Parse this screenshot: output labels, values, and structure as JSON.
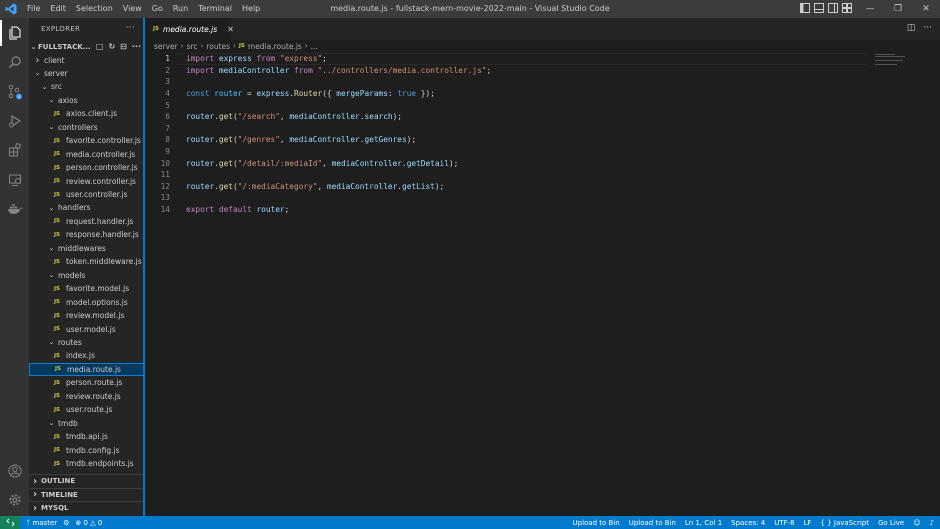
{
  "titlebar": {
    "menu": [
      "File",
      "Edit",
      "Selection",
      "View",
      "Go",
      "Run",
      "Terminal",
      "Help"
    ],
    "title": "media.route.js - fullstack-mern-movie-2022-main - Visual Studio Code"
  },
  "sidebar": {
    "header": "EXPLORER",
    "root": "FULLSTACK...",
    "tree": [
      {
        "label": "client",
        "kind": "folder",
        "open": false,
        "depth": 1
      },
      {
        "label": "server",
        "kind": "folder",
        "open": true,
        "depth": 1
      },
      {
        "label": "src",
        "kind": "folder",
        "open": true,
        "depth": 2
      },
      {
        "label": "axios",
        "kind": "folder",
        "open": true,
        "depth": 3
      },
      {
        "label": "axios.client.js",
        "kind": "file",
        "depth": 4
      },
      {
        "label": "controllers",
        "kind": "folder",
        "open": true,
        "depth": 3
      },
      {
        "label": "favorite.controller.js",
        "kind": "file",
        "depth": 4
      },
      {
        "label": "media.controller.js",
        "kind": "file",
        "depth": 4
      },
      {
        "label": "person.controller.js",
        "kind": "file",
        "depth": 4
      },
      {
        "label": "review.controller.js",
        "kind": "file",
        "depth": 4
      },
      {
        "label": "user.controller.js",
        "kind": "file",
        "depth": 4
      },
      {
        "label": "handlers",
        "kind": "folder",
        "open": true,
        "depth": 3
      },
      {
        "label": "request.handler.js",
        "kind": "file",
        "depth": 4
      },
      {
        "label": "response.handler.js",
        "kind": "file",
        "depth": 4
      },
      {
        "label": "middlewares",
        "kind": "folder",
        "open": true,
        "depth": 3
      },
      {
        "label": "token.middleware.js",
        "kind": "file",
        "depth": 4
      },
      {
        "label": "models",
        "kind": "folder",
        "open": true,
        "depth": 3
      },
      {
        "label": "favorite.model.js",
        "kind": "file",
        "depth": 4
      },
      {
        "label": "model.options.js",
        "kind": "file",
        "depth": 4
      },
      {
        "label": "review.model.js",
        "kind": "file",
        "depth": 4
      },
      {
        "label": "user.model.js",
        "kind": "file",
        "depth": 4
      },
      {
        "label": "routes",
        "kind": "folder",
        "open": true,
        "depth": 3
      },
      {
        "label": "index.js",
        "kind": "file",
        "depth": 4
      },
      {
        "label": "media.route.js",
        "kind": "file",
        "depth": 4,
        "selected": true
      },
      {
        "label": "person.route.js",
        "kind": "file",
        "depth": 4
      },
      {
        "label": "review.route.js",
        "kind": "file",
        "depth": 4
      },
      {
        "label": "user.route.js",
        "kind": "file",
        "depth": 4
      },
      {
        "label": "tmdb",
        "kind": "folder",
        "open": true,
        "depth": 3
      },
      {
        "label": "tmdb.api.js",
        "kind": "file",
        "depth": 4
      },
      {
        "label": "tmdb.config.js",
        "kind": "file",
        "depth": 4
      },
      {
        "label": "tmdb.endpoints.js",
        "kind": "file",
        "depth": 4
      }
    ],
    "sections": [
      "OUTLINE",
      "TIMELINE",
      "MYSQL"
    ]
  },
  "tab": {
    "icon": "JS",
    "label": "media.route.js"
  },
  "breadcrumb": [
    "server",
    "src",
    "routes",
    "media.route.js",
    "..."
  ],
  "editor": {
    "current_line": 1,
    "lines": [
      [
        [
          "kw",
          "import"
        ],
        [
          "pl",
          " "
        ],
        [
          "var",
          "express"
        ],
        [
          "pl",
          " "
        ],
        [
          "kw",
          "from"
        ],
        [
          "pl",
          " "
        ],
        [
          "str",
          "\"express\""
        ],
        [
          "pl",
          ";"
        ]
      ],
      [
        [
          "kw",
          "import"
        ],
        [
          "pl",
          " "
        ],
        [
          "var",
          "mediaController"
        ],
        [
          "pl",
          " "
        ],
        [
          "kw",
          "from"
        ],
        [
          "pl",
          " "
        ],
        [
          "str",
          "\"../controllers/media.controller.js\""
        ],
        [
          "pl",
          ";"
        ]
      ],
      [],
      [
        [
          "kwb",
          "const"
        ],
        [
          "pl",
          " "
        ],
        [
          "cons",
          "router"
        ],
        [
          "pl",
          " = "
        ],
        [
          "var",
          "express"
        ],
        [
          "pl",
          "."
        ],
        [
          "fn",
          "Router"
        ],
        [
          "pl",
          "({ "
        ],
        [
          "var",
          "mergeParams"
        ],
        [
          "pl",
          ": "
        ],
        [
          "kwb",
          "true"
        ],
        [
          "pl",
          " });"
        ]
      ],
      [],
      [
        [
          "var",
          "router"
        ],
        [
          "pl",
          "."
        ],
        [
          "fn",
          "get"
        ],
        [
          "pl",
          "("
        ],
        [
          "str",
          "\"/search\""
        ],
        [
          "pl",
          ", "
        ],
        [
          "var",
          "mediaController"
        ],
        [
          "pl",
          "."
        ],
        [
          "var",
          "search"
        ],
        [
          "pl",
          ");"
        ]
      ],
      [],
      [
        [
          "var",
          "router"
        ],
        [
          "pl",
          "."
        ],
        [
          "fn",
          "get"
        ],
        [
          "pl",
          "("
        ],
        [
          "str",
          "\"/genres\""
        ],
        [
          "pl",
          ", "
        ],
        [
          "var",
          "mediaController"
        ],
        [
          "pl",
          "."
        ],
        [
          "var",
          "getGenres"
        ],
        [
          "pl",
          ");"
        ]
      ],
      [],
      [
        [
          "var",
          "router"
        ],
        [
          "pl",
          "."
        ],
        [
          "fn",
          "get"
        ],
        [
          "pl",
          "("
        ],
        [
          "str",
          "\"/detail/:mediaId\""
        ],
        [
          "pl",
          ", "
        ],
        [
          "var",
          "mediaController"
        ],
        [
          "pl",
          "."
        ],
        [
          "var",
          "getDetail"
        ],
        [
          "pl",
          ");"
        ]
      ],
      [],
      [
        [
          "var",
          "router"
        ],
        [
          "pl",
          "."
        ],
        [
          "fn",
          "get"
        ],
        [
          "pl",
          "("
        ],
        [
          "str",
          "\"/:mediaCategory\""
        ],
        [
          "pl",
          ", "
        ],
        [
          "var",
          "mediaController"
        ],
        [
          "pl",
          "."
        ],
        [
          "var",
          "getList"
        ],
        [
          "pl",
          ");"
        ]
      ],
      [],
      [
        [
          "kw",
          "export"
        ],
        [
          "pl",
          " "
        ],
        [
          "kw",
          "default"
        ],
        [
          "pl",
          " "
        ],
        [
          "var",
          "router"
        ],
        [
          "pl",
          ";"
        ]
      ]
    ]
  },
  "statusbar": {
    "branch": "master",
    "errors": "0",
    "warnings": "0",
    "right": [
      "Upload to Bin",
      "Upload to Bin",
      "Ln 1, Col 1",
      "Spaces: 4",
      "UTF-8",
      "LF",
      "{ } JavaScript",
      "Go Live"
    ]
  }
}
